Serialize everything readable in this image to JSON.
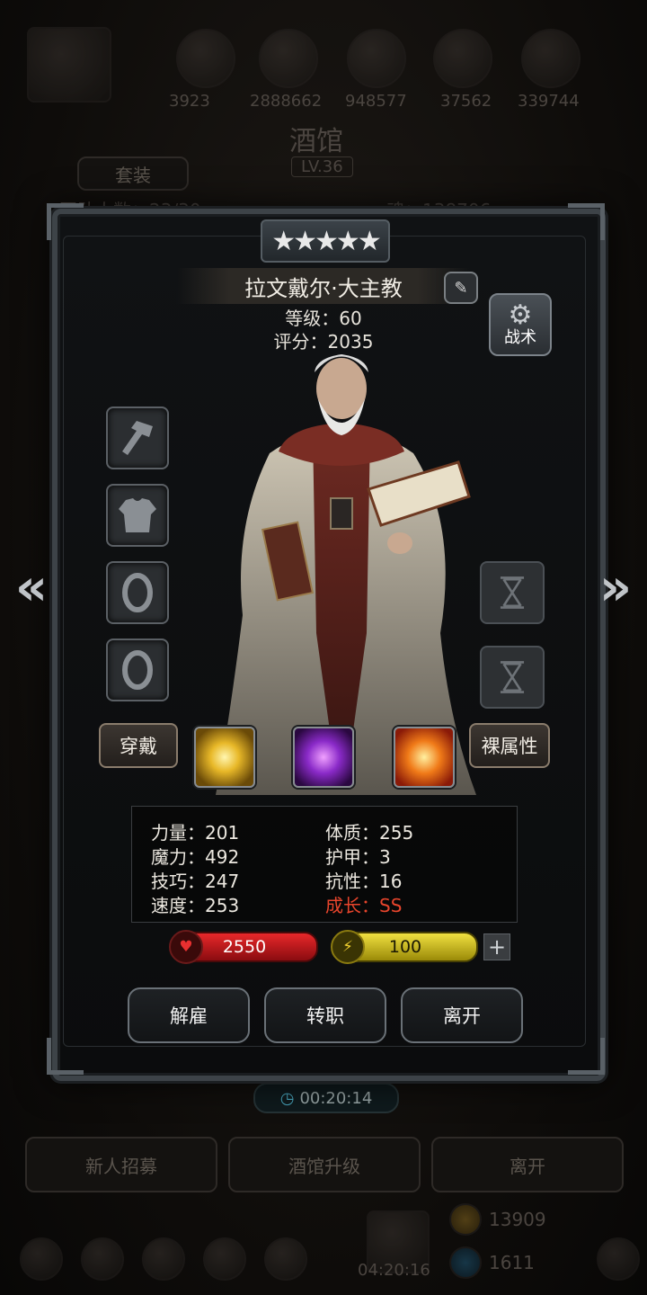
{
  "background": {
    "resource_numbers": [
      "3923",
      "2888662",
      "948577",
      "37562",
      "339744"
    ],
    "title": "酒馆",
    "tab_set": "套装",
    "level": "LV.36",
    "heroes_count": "团队人数：23/30",
    "soul": "魂：138706",
    "timer": "00:20:14",
    "bottom_buttons": [
      "新人招募",
      "酒馆升级",
      "离开"
    ],
    "gold": "13909",
    "gems": "1611",
    "bottom_timer": "04:20:16"
  },
  "hero": {
    "stars": "★★★★★",
    "name": "拉文戴尔·大主教",
    "level_text": "等级：60",
    "score_text": "评分：2035",
    "tactics_label": "战术"
  },
  "equipment_slots": [
    "hammer-icon",
    "armor-icon",
    "ring-icon",
    "ring-icon"
  ],
  "hourglass_slots": [
    "hourglass-icon",
    "hourglass-icon"
  ],
  "wear_label": "穿戴",
  "naked_attr_label": "裸属性",
  "skills": [
    "light-burst-skill",
    "arcane-note-skill",
    "holy-fire-skill"
  ],
  "stats": {
    "strength": "力量：201",
    "magic": "魔力：492",
    "skill": "技巧：247",
    "speed": "速度：253",
    "constitution": "体质：255",
    "armor": "护甲：3",
    "resistance": "抗性：16",
    "growth": "成长：SS"
  },
  "hp": "2550",
  "energy": "100",
  "actions": {
    "dismiss": "解雇",
    "transfer": "转职",
    "leave": "离开"
  },
  "colors": {
    "hp_bar": "#c4161c",
    "energy_bar": "#d9c41a",
    "growth_text": "#e8452c"
  }
}
